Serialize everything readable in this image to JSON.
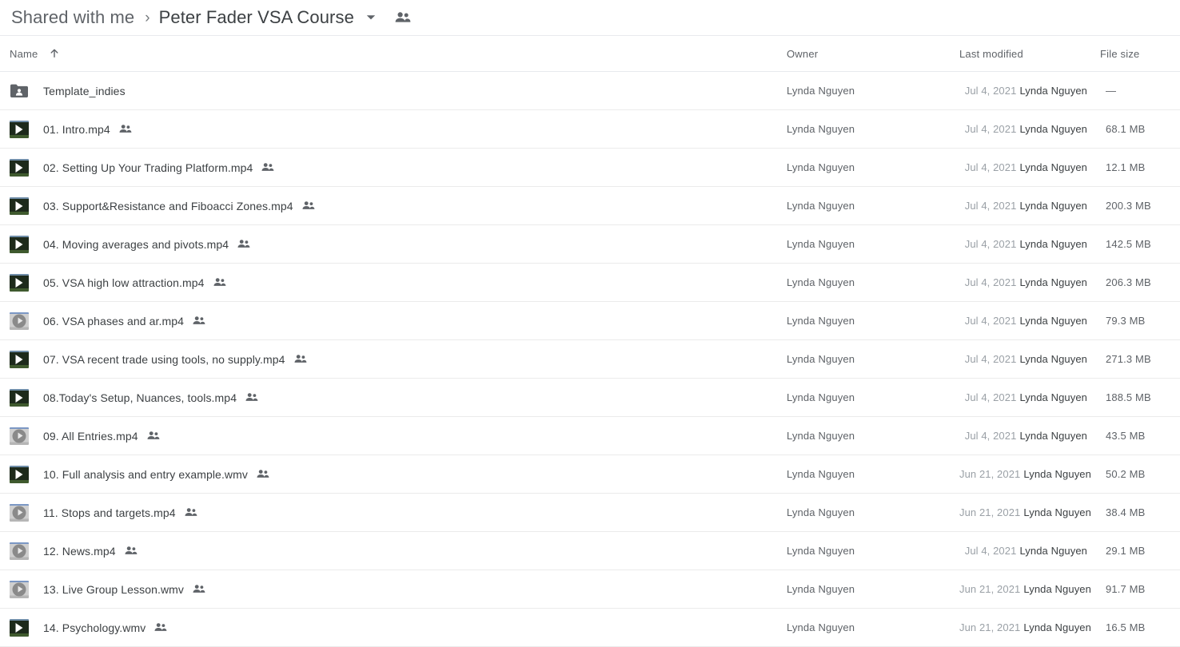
{
  "breadcrumb": {
    "root_label": "Shared with me",
    "separator": "›",
    "current_label": "Peter Fader VSA Course",
    "caret_icon": "chevron-down-icon",
    "people_icon": "people-shared-icon"
  },
  "columns": {
    "name": "Name",
    "sort_arrow": "↑",
    "owner": "Owner",
    "last_modified": "Last modified",
    "file_size": "File size"
  },
  "colors": {
    "text_primary": "#3c4043",
    "text_secondary": "#5f6368",
    "text_muted": "#9aa0a6",
    "divider": "#ebebeb",
    "background": "#ffffff"
  },
  "rows": [
    {
      "name": "Template_indies",
      "icon": "shared-folder-icon",
      "shared": false,
      "owner": "Lynda Nguyen",
      "modified_date": "Jul 4, 2021",
      "modified_by": "Lynda Nguyen",
      "size": "—"
    },
    {
      "name": "01. Intro.mp4",
      "icon": "video-thumbnail-dark-icon",
      "shared": true,
      "owner": "Lynda Nguyen",
      "modified_date": "Jul 4, 2021",
      "modified_by": "Lynda Nguyen",
      "size": "68.1 MB"
    },
    {
      "name": "02. Setting Up Your Trading Platform.mp4",
      "icon": "video-thumbnail-dark-icon",
      "shared": true,
      "owner": "Lynda Nguyen",
      "modified_date": "Jul 4, 2021",
      "modified_by": "Lynda Nguyen",
      "size": "12.1 MB"
    },
    {
      "name": "03. Support&Resistance and Fiboacci Zones.mp4",
      "icon": "video-thumbnail-dark-icon",
      "shared": true,
      "owner": "Lynda Nguyen",
      "modified_date": "Jul 4, 2021",
      "modified_by": "Lynda Nguyen",
      "size": "200.3 MB"
    },
    {
      "name": "04. Moving averages and pivots.mp4",
      "icon": "video-thumbnail-dark-icon",
      "shared": true,
      "owner": "Lynda Nguyen",
      "modified_date": "Jul 4, 2021",
      "modified_by": "Lynda Nguyen",
      "size": "142.5 MB"
    },
    {
      "name": "05. VSA high low attraction.mp4",
      "icon": "video-thumbnail-dark-icon",
      "shared": true,
      "owner": "Lynda Nguyen",
      "modified_date": "Jul 4, 2021",
      "modified_by": "Lynda Nguyen",
      "size": "206.3 MB"
    },
    {
      "name": "06. VSA phases and ar.mp4",
      "icon": "video-thumbnail-light-icon",
      "shared": true,
      "owner": "Lynda Nguyen",
      "modified_date": "Jul 4, 2021",
      "modified_by": "Lynda Nguyen",
      "size": "79.3 MB"
    },
    {
      "name": "07. VSA recent trade using tools, no supply.mp4",
      "icon": "video-thumbnail-dark-icon",
      "shared": true,
      "owner": "Lynda Nguyen",
      "modified_date": "Jul 4, 2021",
      "modified_by": "Lynda Nguyen",
      "size": "271.3 MB"
    },
    {
      "name": "08.Today's Setup, Nuances, tools.mp4",
      "icon": "video-thumbnail-dark-icon",
      "shared": true,
      "owner": "Lynda Nguyen",
      "modified_date": "Jul 4, 2021",
      "modified_by": "Lynda Nguyen",
      "size": "188.5 MB"
    },
    {
      "name": "09. All Entries.mp4",
      "icon": "video-thumbnail-light-icon",
      "shared": true,
      "owner": "Lynda Nguyen",
      "modified_date": "Jul 4, 2021",
      "modified_by": "Lynda Nguyen",
      "size": "43.5 MB"
    },
    {
      "name": "10. Full analysis and entry example.wmv",
      "icon": "video-thumbnail-dark-icon",
      "shared": true,
      "owner": "Lynda Nguyen",
      "modified_date": "Jun 21, 2021",
      "modified_by": "Lynda Nguyen",
      "size": "50.2 MB"
    },
    {
      "name": "11. Stops and targets.mp4",
      "icon": "video-thumbnail-light-icon",
      "shared": true,
      "owner": "Lynda Nguyen",
      "modified_date": "Jun 21, 2021",
      "modified_by": "Lynda Nguyen",
      "size": "38.4 MB"
    },
    {
      "name": "12. News.mp4",
      "icon": "video-thumbnail-light-icon",
      "shared": true,
      "owner": "Lynda Nguyen",
      "modified_date": "Jul 4, 2021",
      "modified_by": "Lynda Nguyen",
      "size": "29.1 MB"
    },
    {
      "name": "13. Live Group Lesson.wmv",
      "icon": "video-thumbnail-light-icon",
      "shared": true,
      "owner": "Lynda Nguyen",
      "modified_date": "Jun 21, 2021",
      "modified_by": "Lynda Nguyen",
      "size": "91.7 MB"
    },
    {
      "name": "14. Psychology.wmv",
      "icon": "video-thumbnail-dark-icon",
      "shared": true,
      "owner": "Lynda Nguyen",
      "modified_date": "Jun 21, 2021",
      "modified_by": "Lynda Nguyen",
      "size": "16.5 MB"
    }
  ]
}
